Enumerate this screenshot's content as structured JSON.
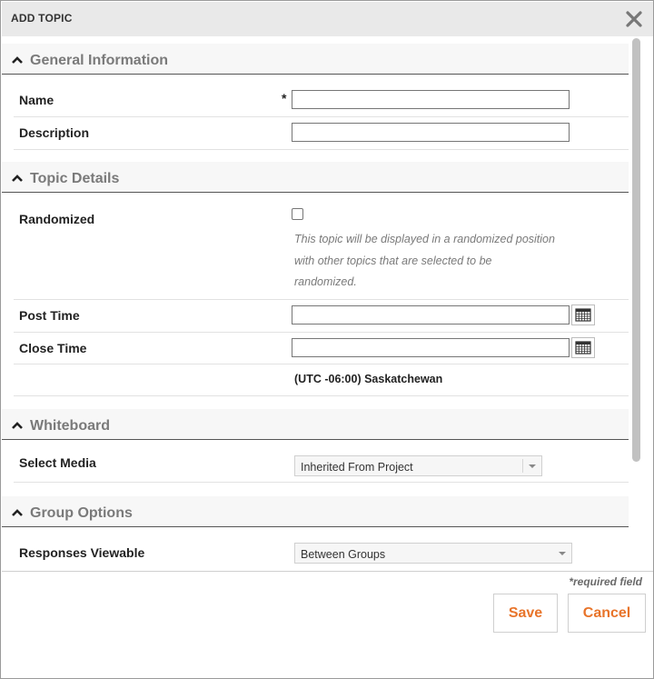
{
  "dialog": {
    "title": "ADD TOPIC"
  },
  "sections": {
    "general": {
      "title": "General Information"
    },
    "details": {
      "title": "Topic Details"
    },
    "whiteboard": {
      "title": "Whiteboard"
    },
    "group": {
      "title": "Group Options"
    }
  },
  "fields": {
    "name": {
      "label": "Name",
      "required_mark": "*",
      "value": ""
    },
    "description": {
      "label": "Description",
      "value": ""
    },
    "randomized": {
      "label": "Randomized",
      "checked": false,
      "hint_lines": [
        "This topic will be displayed in a randomized position",
        "with other topics that are selected to be",
        "randomized."
      ]
    },
    "post_time": {
      "label": "Post Time",
      "value": ""
    },
    "close_time": {
      "label": "Close Time",
      "value": ""
    },
    "timezone": "(UTC -06:00) Saskatchewan",
    "select_media": {
      "label": "Select Media",
      "selected": "Inherited From Project"
    },
    "responses_viewable": {
      "label": "Responses Viewable",
      "selected": "Between Groups"
    }
  },
  "footer": {
    "required_note": "*required field",
    "save_label": "Save",
    "cancel_label": "Cancel"
  },
  "icons": {
    "close": "close-icon",
    "collapse": "chevron-up-icon",
    "calendar": "calendar-icon",
    "dropdown": "caret-down-icon"
  },
  "colors": {
    "accent": "#e8742a",
    "section_title": "#7a7a7a",
    "titlebar_bg": "#e9e9e9"
  }
}
